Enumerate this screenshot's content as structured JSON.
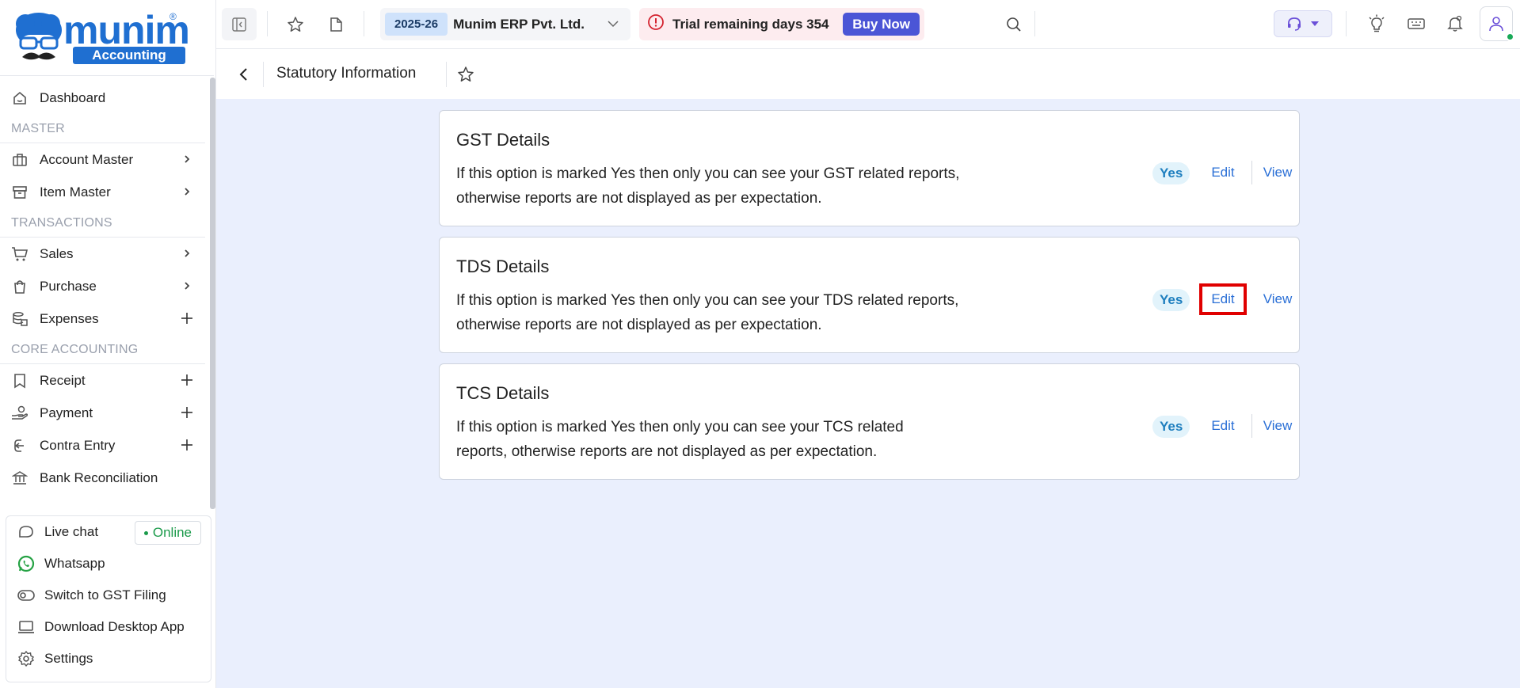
{
  "logo": {
    "word": "munim",
    "badge": "Accounting",
    "reg": "®"
  },
  "sidebar": {
    "dashboard": "Dashboard",
    "sections": {
      "master": "MASTER",
      "transactions": "TRANSACTIONS",
      "core": "CORE ACCOUNTING"
    },
    "items": {
      "account_master": "Account Master",
      "item_master": "Item Master",
      "sales": "Sales",
      "purchase": "Purchase",
      "expenses": "Expenses",
      "receipt": "Receipt",
      "payment": "Payment",
      "contra": "Contra Entry",
      "bank_reco": "Bank Reconciliation"
    },
    "bottom": {
      "live_chat": "Live chat",
      "online": "Online",
      "whatsapp": "Whatsapp",
      "switch_gst": "Switch to GST Filing",
      "download": "Download Desktop App",
      "settings": "Settings"
    }
  },
  "topbar": {
    "year": "2025-26",
    "company": "Munim ERP Pvt. Ltd.",
    "trial": "Trial remaining days 354",
    "buy_now": "Buy Now"
  },
  "page": {
    "title": "Statutory Information",
    "cards": [
      {
        "title": "GST Details",
        "desc_line1": "If this option is marked Yes then only you can see your GST related reports,",
        "desc_line2": "otherwise reports are not displayed as per expectation.",
        "status": "Yes",
        "edit": "Edit",
        "view": "View"
      },
      {
        "title": "TDS Details",
        "desc_line1": "If this option is marked Yes then only you can see your TDS related reports,",
        "desc_line2": "otherwise reports are not displayed as per expectation.",
        "status": "Yes",
        "edit": "Edit",
        "view": "View"
      },
      {
        "title": "TCS Details",
        "desc_line1": "If this option is marked Yes then only you can see your TCS related",
        "desc_line2": "reports, otherwise reports are not displayed as per expectation.",
        "status": "Yes",
        "edit": "Edit",
        "view": "View"
      }
    ]
  },
  "colors": {
    "brand": "#1f6fd1",
    "buy_now": "#4b55d6",
    "main_bg": "#eaeffd",
    "highlight": "#e00000",
    "online": "#1a9a4a"
  }
}
